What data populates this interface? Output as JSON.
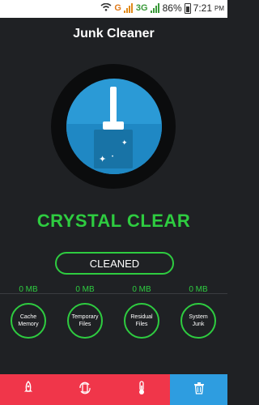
{
  "status_bar": {
    "network_letter": "G",
    "network_3g": "3G",
    "battery": "86%",
    "time": "7:21",
    "ampm": "PM"
  },
  "header": {
    "title": "Junk Cleaner"
  },
  "hero": {
    "status_text": "CRYSTAL CLEAR",
    "button_label": "CLEANED"
  },
  "categories": [
    {
      "size": "0 MB",
      "label1": "Cache",
      "label2": "Memory"
    },
    {
      "size": "0 MB",
      "label1": "Temporary",
      "label2": "Files"
    },
    {
      "size": "0 MB",
      "label1": "Residual",
      "label2": "Files"
    },
    {
      "size": "0 MB",
      "label1": "System",
      "label2": "Junk"
    }
  ],
  "bottom_nav": {
    "items": [
      {
        "icon": "rocket-icon",
        "active": false
      },
      {
        "icon": "phone-refresh-icon",
        "active": false
      },
      {
        "icon": "thermometer-icon",
        "active": false
      },
      {
        "icon": "trash-icon",
        "active": true
      }
    ],
    "colors": {
      "inactive_bg": "#f0364a",
      "active_bg": "#2e9de0"
    }
  },
  "colors": {
    "accent_green": "#2ecc40",
    "background": "#1f2124",
    "blue": "#2b9ad6"
  }
}
